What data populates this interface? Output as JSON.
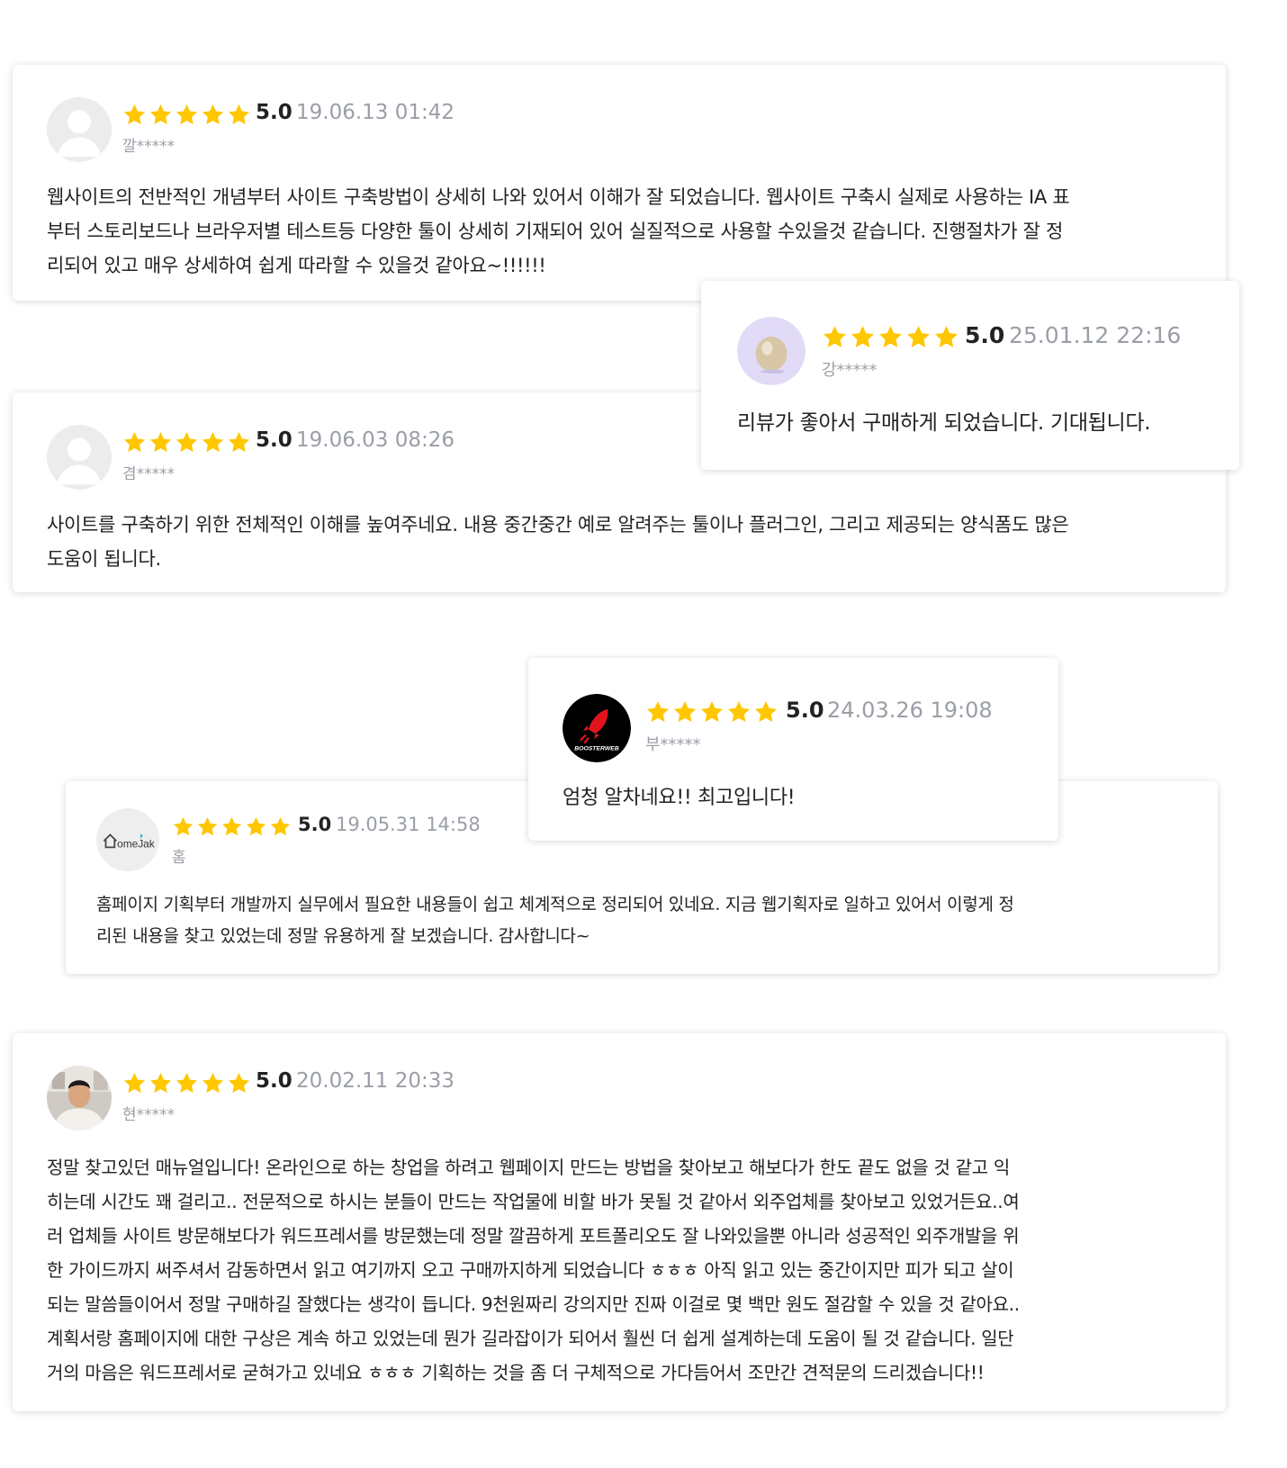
{
  "reviews": [
    {
      "avatar": "default-avatar-icon",
      "score": "5.0",
      "date": "19.06.13 01:42",
      "user": "깔*****",
      "lines": [
        "웹사이트의 전반적인 개념부터 사이트 구축방법이 상세히 나와 있어서 이해가 잘 되었습니다. 웹사이트 구축시 실제로 사용하는 IA 표",
        "부터  스토리보드나 브라우저별 테스트등 다양한 툴이 상세히 기재되어 있어 실질적으로 사용할 수있을것 같습니다. 진행절차가 잘 정",
        "리되어 있고 매우 상세하여 쉽게 따라할 수 있을것 같아요~!!!!!!"
      ]
    },
    {
      "avatar": "default-avatar-icon",
      "score": "5.0",
      "date": "19.06.03 08:26",
      "user": "겸*****",
      "lines": [
        "사이트를 구축하기 위한 전체적인 이해를 높여주네요. 내용 중간중간 예로 알려주는 툴이나 플러그인, 그리고 제공되는 양식폼도 많은",
        "도움이 됩니다."
      ]
    },
    {
      "avatar": "egg-avatar-icon",
      "score": "5.0",
      "date": "25.01.12 22:16",
      "user": "강*****",
      "lines": [
        "리뷰가 좋아서 구매하게 되었습니다. 기대됩니다."
      ]
    },
    {
      "avatar": "homejak-logo",
      "logo_text": "omeJak",
      "score": "5.0",
      "date": "19.05.31 14:58",
      "user": "홈",
      "lines": [
        "홈페이지 기획부터 개발까지 실무에서 필요한 내용들이 쉽고 체계적으로 정리되어 있네요. 지금 웹기획자로 일하고 있어서 이렇게 정",
        "리된 내용을 찾고 있었는데 정말 유용하게 잘 보겠습니다. 감사합니다~"
      ]
    },
    {
      "avatar": "boosterweb-logo",
      "logo_text": "BOOSTERWEB",
      "score": "5.0",
      "date": "24.03.26 19:08",
      "user": "부*****",
      "lines": [
        "엄청 알차네요!! 최고입니다!"
      ]
    },
    {
      "avatar": "user-photo",
      "score": "5.0",
      "date": "20.02.11 20:33",
      "user": "현*****",
      "lines": [
        "정말 찾고있던 매뉴얼입니다! 온라인으로 하는 창업을 하려고 웹페이지 만드는 방법을 찾아보고 해보다가 한도 끝도 없을 것 같고 익",
        "히는데 시간도 꽤 걸리고.. 전문적으로 하시는 분들이 만드는 작업물에 비할 바가 못될 것 같아서 외주업체를 찾아보고 있었거든요..여",
        "러 업체들 사이트 방문해보다가 워드프레서를 방문했는데 정말 깔끔하게 포트폴리오도 잘 나와있을뿐 아니라 성공적인 외주개발을 위",
        "한 가이드까지 써주셔서 감동하면서 읽고 여기까지 오고 구매까지하게 되었습니다 ㅎㅎㅎ 아직 읽고 있는 중간이지만 피가 되고 살이",
        "되는 말씀들이어서 정말 구매하길 잘했다는 생각이 듭니다. 9천원짜리 강의지만 진짜 이걸로 몇 백만 원도 절감할 수 있을 것 같아요..",
        "계획서랑 홈페이지에 대한 구상은 계속 하고 있었는데 뭔가 길라잡이가 되어서 훨씬 더 쉽게 설계하는데 도움이 될 것 같습니다. 일단",
        "거의 마음은 워드프레서로 굳혀가고 있네요 ㅎㅎㅎ 기획하는 것을 좀 더 구체적으로 가다듬어서 조만간 견적문의 드리겠습니다!!"
      ]
    }
  ],
  "colors": {
    "star": "#FFC700",
    "meta": "#9a9ea6",
    "text": "#222222"
  }
}
